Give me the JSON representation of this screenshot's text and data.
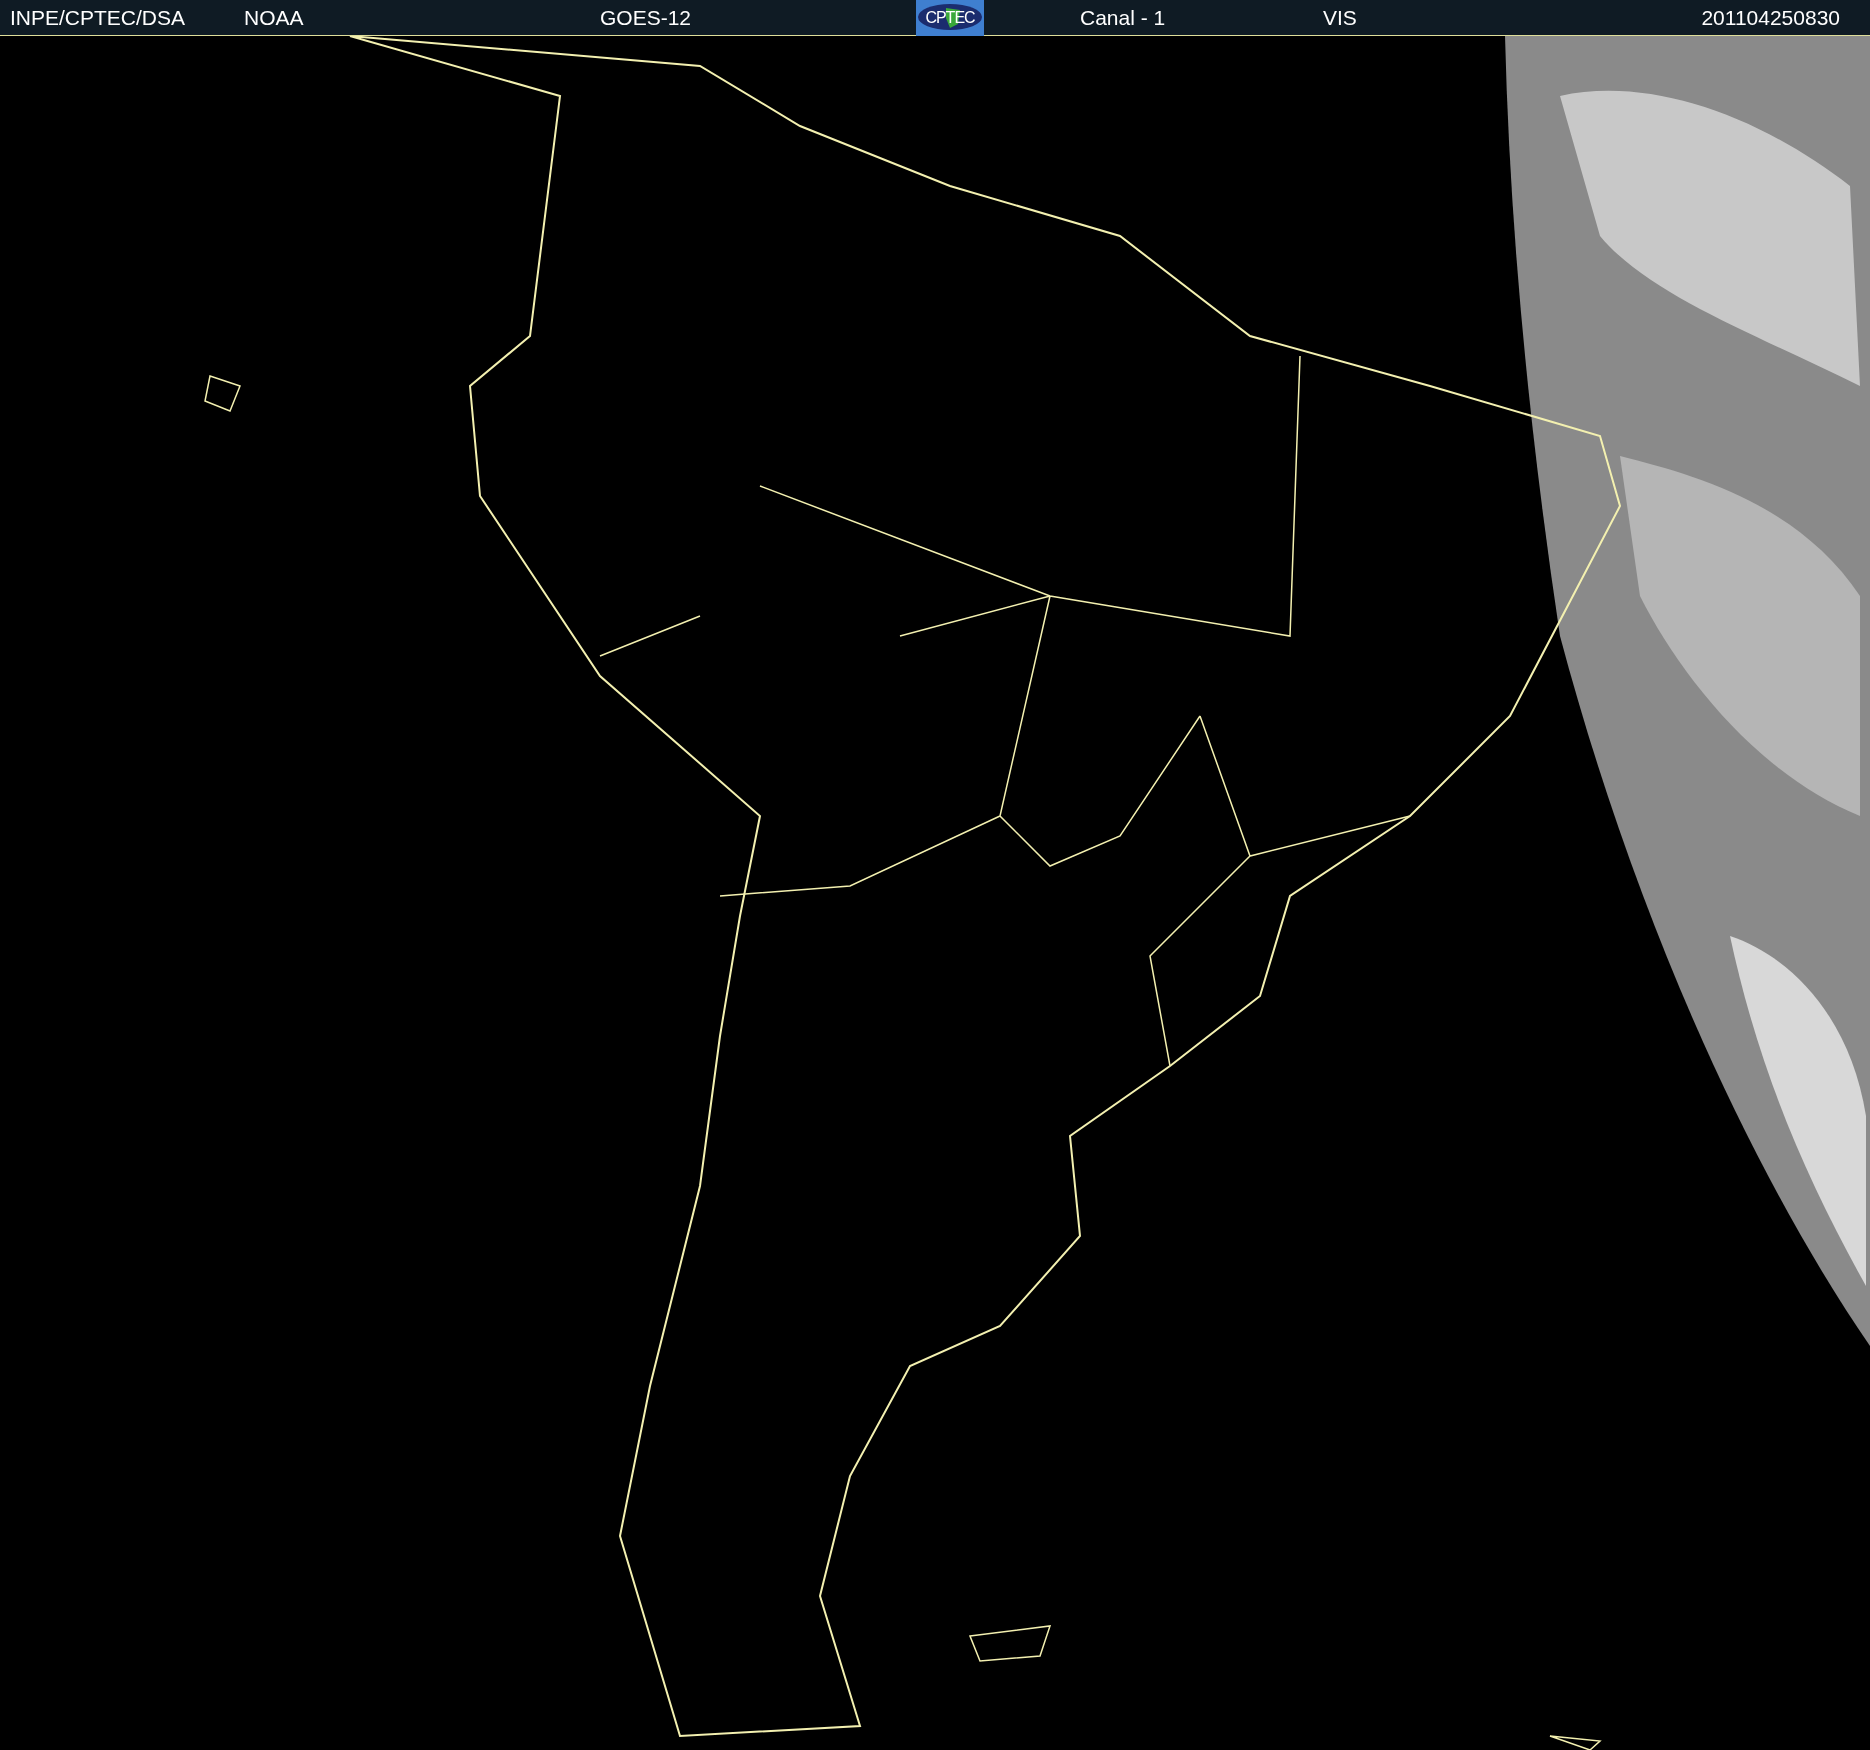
{
  "header": {
    "items": [
      {
        "kind": "text",
        "text": "INPE/CPTEC/DSA"
      },
      {
        "kind": "text",
        "text": "NOAA"
      },
      {
        "kind": "text",
        "text": "GOES-12"
      },
      {
        "kind": "logo",
        "text": "CPTEC"
      },
      {
        "kind": "text",
        "text": "Canal - 1"
      },
      {
        "kind": "text",
        "text": "VIS"
      },
      {
        "kind": "text",
        "text": "201104250830"
      }
    ]
  }
}
